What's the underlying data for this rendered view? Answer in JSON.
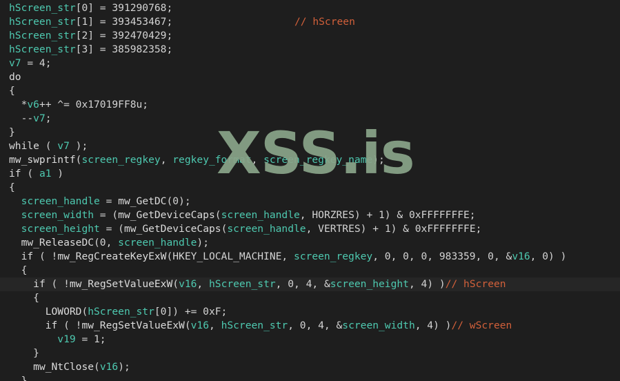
{
  "code_lines": [
    {
      "segments": [
        {
          "t": "hScreen_str",
          "c": "v"
        },
        {
          "t": "[0] = 391290768;",
          "c": "n"
        }
      ],
      "comment": ""
    },
    {
      "segments": [
        {
          "t": "hScreen_str",
          "c": "v"
        },
        {
          "t": "[1] = 393453467;",
          "c": "n"
        }
      ],
      "comment": "// hScreen",
      "comment_col": 414
    },
    {
      "segments": [
        {
          "t": "hScreen_str",
          "c": "v"
        },
        {
          "t": "[2] = 392470429;",
          "c": "n"
        }
      ],
      "comment": ""
    },
    {
      "segments": [
        {
          "t": "hScreen_str",
          "c": "v"
        },
        {
          "t": "[3] = 385982358;",
          "c": "n"
        }
      ],
      "comment": ""
    },
    {
      "segments": [
        {
          "t": "v7",
          "c": "v"
        },
        {
          "t": " = 4;",
          "c": "n"
        }
      ],
      "comment": ""
    },
    {
      "segments": [
        {
          "t": "do",
          "c": "f"
        }
      ],
      "comment": ""
    },
    {
      "segments": [
        {
          "t": "{",
          "c": "n"
        }
      ],
      "comment": ""
    },
    {
      "segments": [
        {
          "t": "  *",
          "c": "n"
        },
        {
          "t": "v6",
          "c": "v"
        },
        {
          "t": "++ ^= 0x17019FF8u;",
          "c": "n"
        }
      ],
      "comment": ""
    },
    {
      "segments": [
        {
          "t": "  --",
          "c": "n"
        },
        {
          "t": "v7",
          "c": "v"
        },
        {
          "t": ";",
          "c": "n"
        }
      ],
      "comment": ""
    },
    {
      "segments": [
        {
          "t": "}",
          "c": "n"
        }
      ],
      "comment": ""
    },
    {
      "segments": [
        {
          "t": "while",
          "c": "f"
        },
        {
          "t": " ( ",
          "c": "n"
        },
        {
          "t": "v7",
          "c": "v"
        },
        {
          "t": " );",
          "c": "n"
        }
      ],
      "comment": ""
    },
    {
      "segments": [
        {
          "t": "mw_swprintf",
          "c": "f"
        },
        {
          "t": "(",
          "c": "n"
        },
        {
          "t": "screen_regkey",
          "c": "v"
        },
        {
          "t": ", ",
          "c": "n"
        },
        {
          "t": "regkey_format",
          "c": "v"
        },
        {
          "t": ", ",
          "c": "n"
        },
        {
          "t": "screen_regkey_name",
          "c": "v"
        },
        {
          "t": ");",
          "c": "n"
        }
      ],
      "comment": ""
    },
    {
      "segments": [
        {
          "t": "if",
          "c": "f"
        },
        {
          "t": " ( ",
          "c": "n"
        },
        {
          "t": "a1",
          "c": "v"
        },
        {
          "t": " )",
          "c": "n"
        }
      ],
      "comment": ""
    },
    {
      "segments": [
        {
          "t": "{",
          "c": "n"
        }
      ],
      "comment": ""
    },
    {
      "segments": [
        {
          "t": "  ",
          "c": "n"
        },
        {
          "t": "screen_handle",
          "c": "v"
        },
        {
          "t": " = ",
          "c": "n"
        },
        {
          "t": "mw_GetDC",
          "c": "f"
        },
        {
          "t": "(0);",
          "c": "n"
        }
      ],
      "comment": ""
    },
    {
      "segments": [
        {
          "t": "  ",
          "c": "n"
        },
        {
          "t": "screen_width",
          "c": "v"
        },
        {
          "t": " = (",
          "c": "n"
        },
        {
          "t": "mw_GetDeviceCaps",
          "c": "f"
        },
        {
          "t": "(",
          "c": "n"
        },
        {
          "t": "screen_handle",
          "c": "v"
        },
        {
          "t": ", HORZRES) + 1) & 0xFFFFFFFE;",
          "c": "n"
        }
      ],
      "comment": ""
    },
    {
      "segments": [
        {
          "t": "  ",
          "c": "n"
        },
        {
          "t": "screen_height",
          "c": "v"
        },
        {
          "t": " = (",
          "c": "n"
        },
        {
          "t": "mw_GetDeviceCaps",
          "c": "f"
        },
        {
          "t": "(",
          "c": "n"
        },
        {
          "t": "screen_handle",
          "c": "v"
        },
        {
          "t": ", VERTRES) + 1) & 0xFFFFFFFE;",
          "c": "n"
        }
      ],
      "comment": ""
    },
    {
      "segments": [
        {
          "t": "  ",
          "c": "n"
        },
        {
          "t": "mw_ReleaseDC",
          "c": "f"
        },
        {
          "t": "(0, ",
          "c": "n"
        },
        {
          "t": "screen_handle",
          "c": "v"
        },
        {
          "t": ");",
          "c": "n"
        }
      ],
      "comment": ""
    },
    {
      "segments": [
        {
          "t": "  ",
          "c": "n"
        },
        {
          "t": "if",
          "c": "f"
        },
        {
          "t": " ( !",
          "c": "n"
        },
        {
          "t": "mw_RegCreateKeyExW",
          "c": "f"
        },
        {
          "t": "(HKEY_LOCAL_MACHINE, ",
          "c": "n"
        },
        {
          "t": "screen_regkey",
          "c": "v"
        },
        {
          "t": ", 0, 0, 0, 983359, 0, &",
          "c": "n"
        },
        {
          "t": "v16",
          "c": "v"
        },
        {
          "t": ", 0) )",
          "c": "n"
        }
      ],
      "comment": ""
    },
    {
      "segments": [
        {
          "t": "  {",
          "c": "n"
        }
      ],
      "comment": ""
    },
    {
      "segments": [
        {
          "t": "    ",
          "c": "n"
        },
        {
          "t": "if",
          "c": "f"
        },
        {
          "t": " ( !",
          "c": "n"
        },
        {
          "t": "mw_RegSetValueExW",
          "c": "f"
        },
        {
          "t": "(",
          "c": "n"
        },
        {
          "t": "v16",
          "c": "v"
        },
        {
          "t": ", ",
          "c": "n"
        },
        {
          "t": "hScreen_str",
          "c": "v"
        },
        {
          "t": ", 0, 4, &",
          "c": "n"
        },
        {
          "t": "screen_height",
          "c": "v"
        },
        {
          "t": ", 4) )",
          "c": "n"
        }
      ],
      "comment": "// hScreen",
      "highlight": true
    },
    {
      "segments": [
        {
          "t": "    {",
          "c": "n"
        }
      ],
      "comment": ""
    },
    {
      "segments": [
        {
          "t": "      ",
          "c": "n"
        },
        {
          "t": "LOWORD",
          "c": "f"
        },
        {
          "t": "(",
          "c": "n"
        },
        {
          "t": "hScreen_str",
          "c": "v"
        },
        {
          "t": "[0]) += 0xF;",
          "c": "n"
        }
      ],
      "comment": ""
    },
    {
      "segments": [
        {
          "t": "      ",
          "c": "n"
        },
        {
          "t": "if",
          "c": "f"
        },
        {
          "t": " ( !",
          "c": "n"
        },
        {
          "t": "mw_RegSetValueExW",
          "c": "f"
        },
        {
          "t": "(",
          "c": "n"
        },
        {
          "t": "v16",
          "c": "v"
        },
        {
          "t": ", ",
          "c": "n"
        },
        {
          "t": "hScreen_str",
          "c": "v"
        },
        {
          "t": ", 0, 4, &",
          "c": "n"
        },
        {
          "t": "screen_width",
          "c": "v"
        },
        {
          "t": ", 4) )",
          "c": "n"
        }
      ],
      "comment": "// wScreen"
    },
    {
      "segments": [
        {
          "t": "        ",
          "c": "n"
        },
        {
          "t": "v19",
          "c": "v"
        },
        {
          "t": " = 1;",
          "c": "n"
        }
      ],
      "comment": ""
    },
    {
      "segments": [
        {
          "t": "    }",
          "c": "n"
        }
      ],
      "comment": ""
    },
    {
      "segments": [
        {
          "t": "    ",
          "c": "n"
        },
        {
          "t": "mw_NtClose",
          "c": "f"
        },
        {
          "t": "(",
          "c": "n"
        },
        {
          "t": "v16",
          "c": "v"
        },
        {
          "t": ");",
          "c": "n"
        }
      ],
      "comment": ""
    },
    {
      "segments": [
        {
          "t": "  }",
          "c": "n"
        }
      ],
      "comment": ""
    }
  ],
  "watermark": "XSS.is",
  "colors": {
    "background": "#1e1e1e",
    "variable": "#4ec9b0",
    "comment": "#d2603a",
    "text": "#d4d4d4"
  }
}
